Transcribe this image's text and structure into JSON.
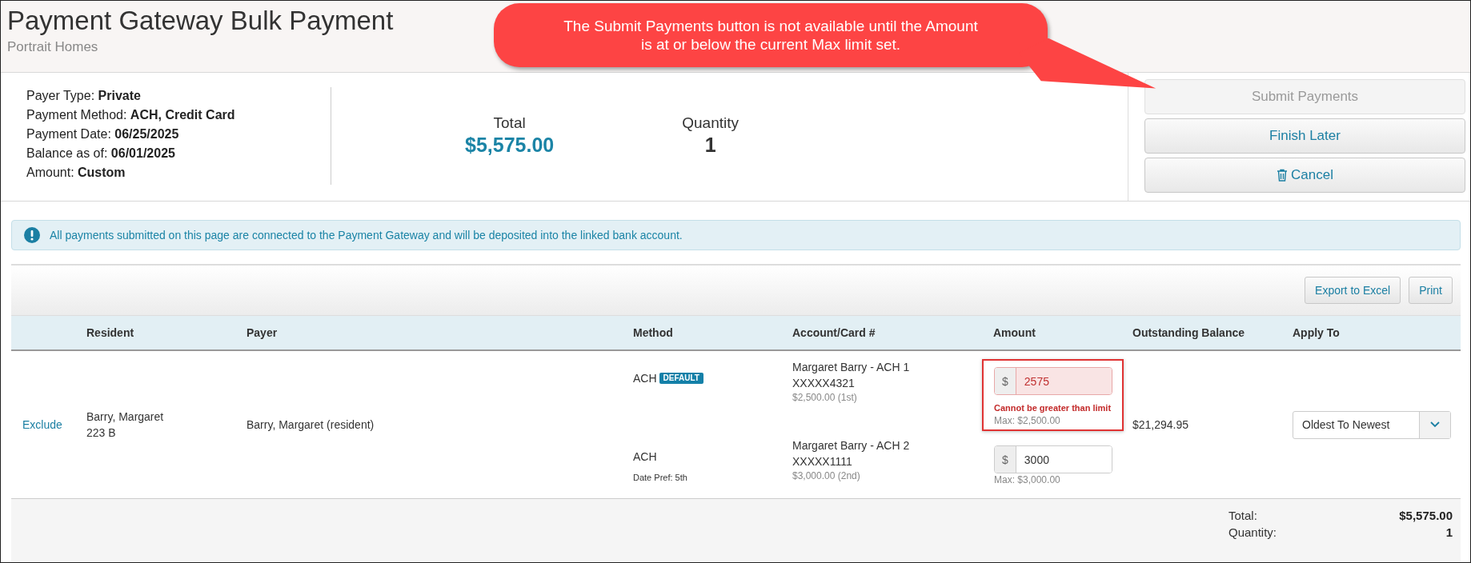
{
  "header": {
    "title": "Payment Gateway Bulk Payment",
    "subtitle": "Portrait Homes"
  },
  "callout": {
    "lines": [
      "The Submit Payments button is not available until the Amount",
      "is at or below the current Max limit set."
    ]
  },
  "summary": {
    "details": [
      {
        "label": "Payer Type:",
        "value": "Private"
      },
      {
        "label": "Payment Method:",
        "value": "ACH, Credit Card"
      },
      {
        "label": "Payment Date:",
        "value": "06/25/2025"
      },
      {
        "label": "Balance as of:",
        "value": "06/01/2025"
      },
      {
        "label": "Amount:",
        "value": "Custom"
      }
    ],
    "stats": [
      {
        "label": "Total",
        "value": "$5,575.00",
        "kind": "money"
      },
      {
        "label": "Quantity",
        "value": "1",
        "kind": "count"
      }
    ]
  },
  "actions": [
    {
      "label": "Submit Payments",
      "disabled": true,
      "kind": "plain"
    },
    {
      "label": "Finish Later",
      "disabled": false,
      "kind": "plain"
    },
    {
      "label": "Cancel",
      "disabled": false,
      "kind": "trash"
    }
  ],
  "alert": {
    "text": "All payments submitted on this page are connected to the Payment Gateway and will be deposited into the linked bank account."
  },
  "toolbar": [
    "Export to Excel",
    "Print"
  ],
  "table": {
    "columns": [
      "Resident",
      "Payer",
      "Method",
      "Account/Card #",
      "Amount",
      "Outstanding Balance",
      "Apply To"
    ],
    "rows": [
      {
        "action": "Exclude",
        "resident": [
          "Barry, Margaret",
          "223 B"
        ],
        "payer": "Barry, Margaret (resident)",
        "balance": "$21,294.95",
        "apply_to": "Oldest To Newest",
        "accounts": [
          {
            "method": "ACH",
            "badge": "DEFAULT",
            "name": "Margaret Barry - ACH 1",
            "number": "XXXXX4321",
            "limit": "$2,500.00 (1st)",
            "currency": "$",
            "amount": "2575",
            "invalid": true,
            "error": "Cannot be greater than limit",
            "max": "Max: $2,500.00"
          },
          {
            "method": "ACH",
            "date_pref": "Date Pref: 5th",
            "name": "Margaret Barry - ACH 2",
            "number": "XXXXX1111",
            "limit": "$3,000.00 (2nd)",
            "currency": "$",
            "amount": "3000",
            "invalid": false,
            "max": "Max: $3,000.00"
          }
        ]
      }
    ],
    "footer": [
      {
        "label": "Total:",
        "value": "$5,575.00"
      },
      {
        "label": "Quantity:",
        "value": "1"
      }
    ]
  }
}
